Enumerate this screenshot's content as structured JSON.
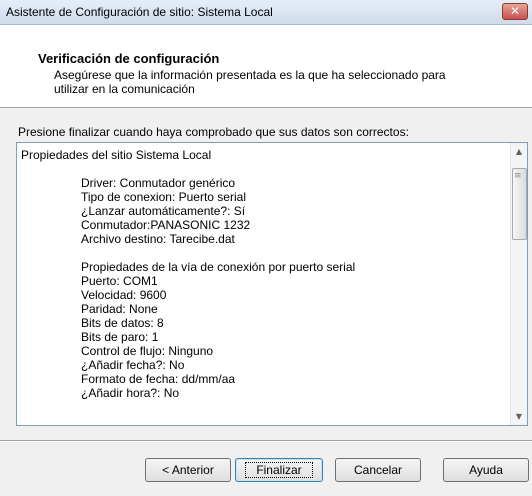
{
  "window": {
    "title": "Asistente de Configuración de sitio: Sistema Local",
    "close_glyph": "✕"
  },
  "header": {
    "title": "Verificación de configuración",
    "description": "Asegúrese que la información presentada es la que ha seleccionado para utilizar en la comunicación"
  },
  "intro": "Presione finalizar cuando haya comprobado que sus datos son correctos:",
  "properties": {
    "heading": "Propiedades del sitio Sistema Local",
    "site_lines": [
      "Driver: Conmutador genérico",
      "Tipo de conexion: Puerto serial",
      "¿Lanzar automáticamente?: Sí",
      "Conmutador:PANASONIC 1232",
      "Archivo destino: Tarecibe.dat"
    ],
    "serial_lines": [
      "Propiedades de la vía de conexión por puerto serial",
      "Puerto: COM1",
      "Velocidad: 9600",
      "Paridad: None",
      "Bits de datos: 8",
      "Bits de paro: 1",
      "Control de flujo: Ninguno",
      "¿Añadir fecha?: No",
      "Formato de fecha: dd/mm/aa",
      "¿Añadir hora?: No"
    ]
  },
  "scrollbar": {
    "up_glyph": "▲",
    "down_glyph": "▼",
    "grip_glyph": "≡"
  },
  "buttons": {
    "back": "< Anterior",
    "finish": "Finalizar",
    "cancel": "Cancelar",
    "help": "Ayuda"
  }
}
